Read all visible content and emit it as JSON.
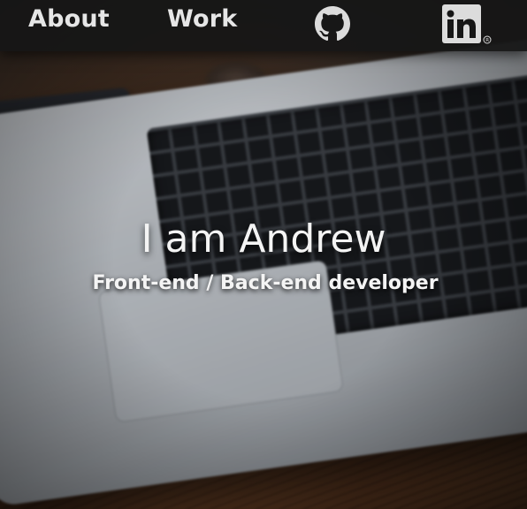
{
  "nav": {
    "about_label": "About",
    "work_label": "Work",
    "github_icon": "github-icon",
    "linkedin_icon": "linkedin-icon",
    "linkedin_text": "in"
  },
  "hero": {
    "title": "I am Andrew",
    "subtitle": "Front-end / Back-end developer",
    "background": "laptop-on-desk-photo"
  },
  "colors": {
    "nav_background": "#161616",
    "nav_text": "#e6e6e6",
    "hero_text": "#f4f4f4",
    "linkedin_badge": "#dcdcdc"
  }
}
